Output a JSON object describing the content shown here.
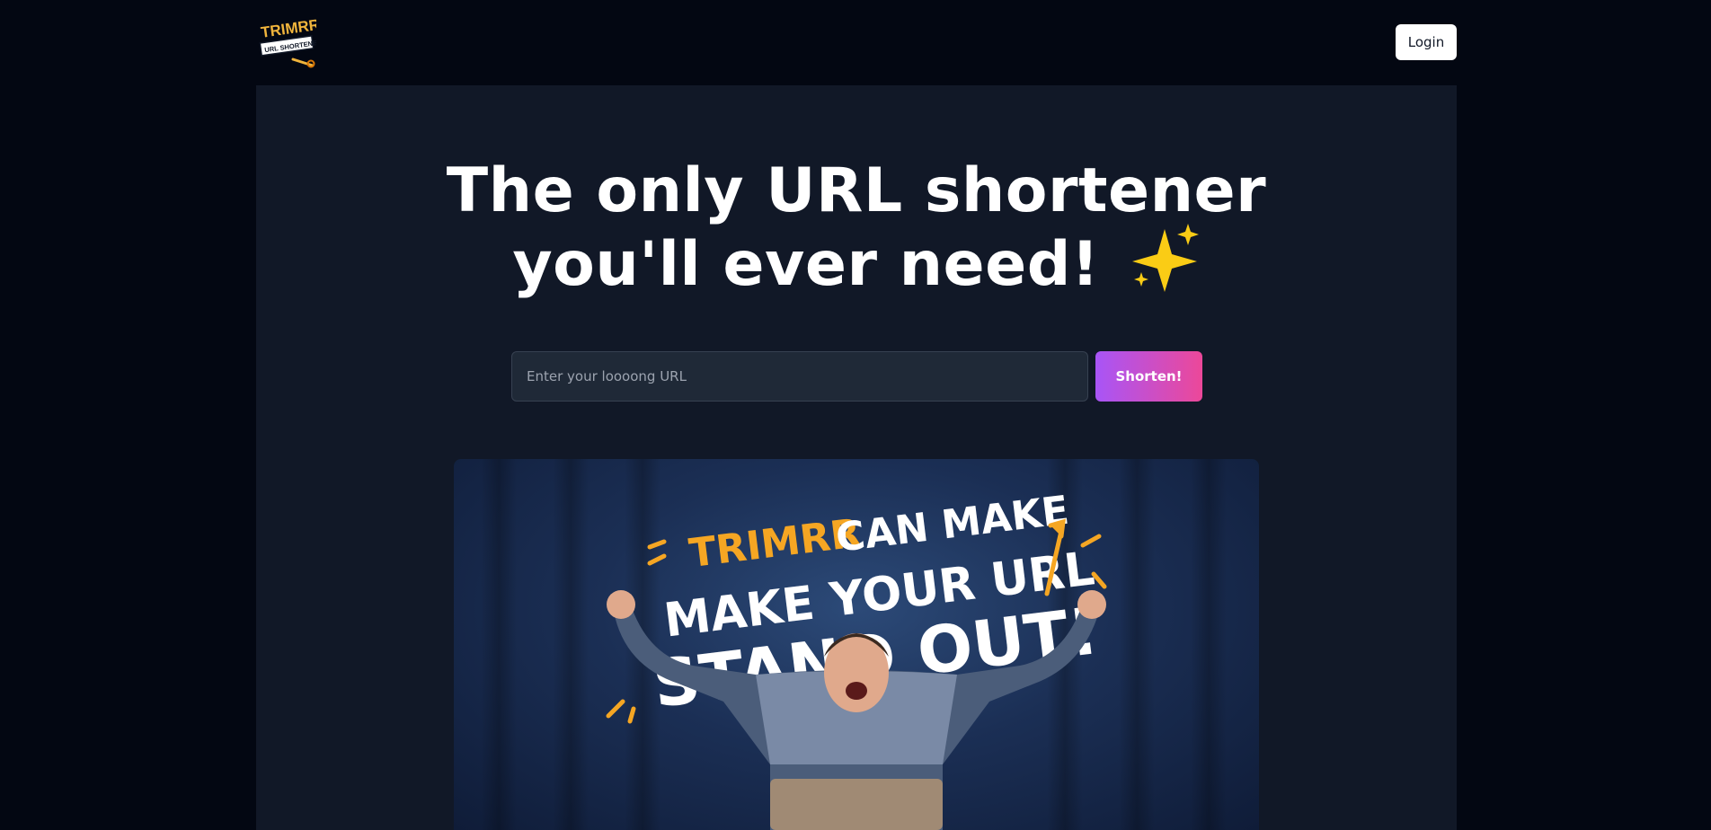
{
  "header": {
    "logo": {
      "line1": "TRIMRR",
      "line2": "URL SHORTENER",
      "colors": {
        "gold": "#f0b43c",
        "ribbon": "#ffffff",
        "ink": "#111827"
      }
    },
    "login_label": "Login"
  },
  "hero": {
    "headline_line1": "The only URL shortener",
    "headline_line2": "you'll ever need!",
    "headline_emoji": "sparkles-icon",
    "url_input_value": "",
    "url_input_placeholder": "Enter your loooong URL",
    "shorten_label": "Shorten!",
    "shorten_gradient": [
      "#a855f7",
      "#ec4899"
    ]
  },
  "banner": {
    "word_brand": "TRIMRR",
    "word_can_make": "CAN MAKE",
    "word_make_your_url": "MAKE YOUR URL",
    "word_stand_out": "STAND OUT!",
    "colors": {
      "gold": "#f5a623",
      "text": "#ffffff",
      "curtain": "#1b2f55"
    }
  },
  "colors": {
    "page_bg": "#030712",
    "panel_bg": "#111827",
    "input_bg": "#1f2937"
  }
}
